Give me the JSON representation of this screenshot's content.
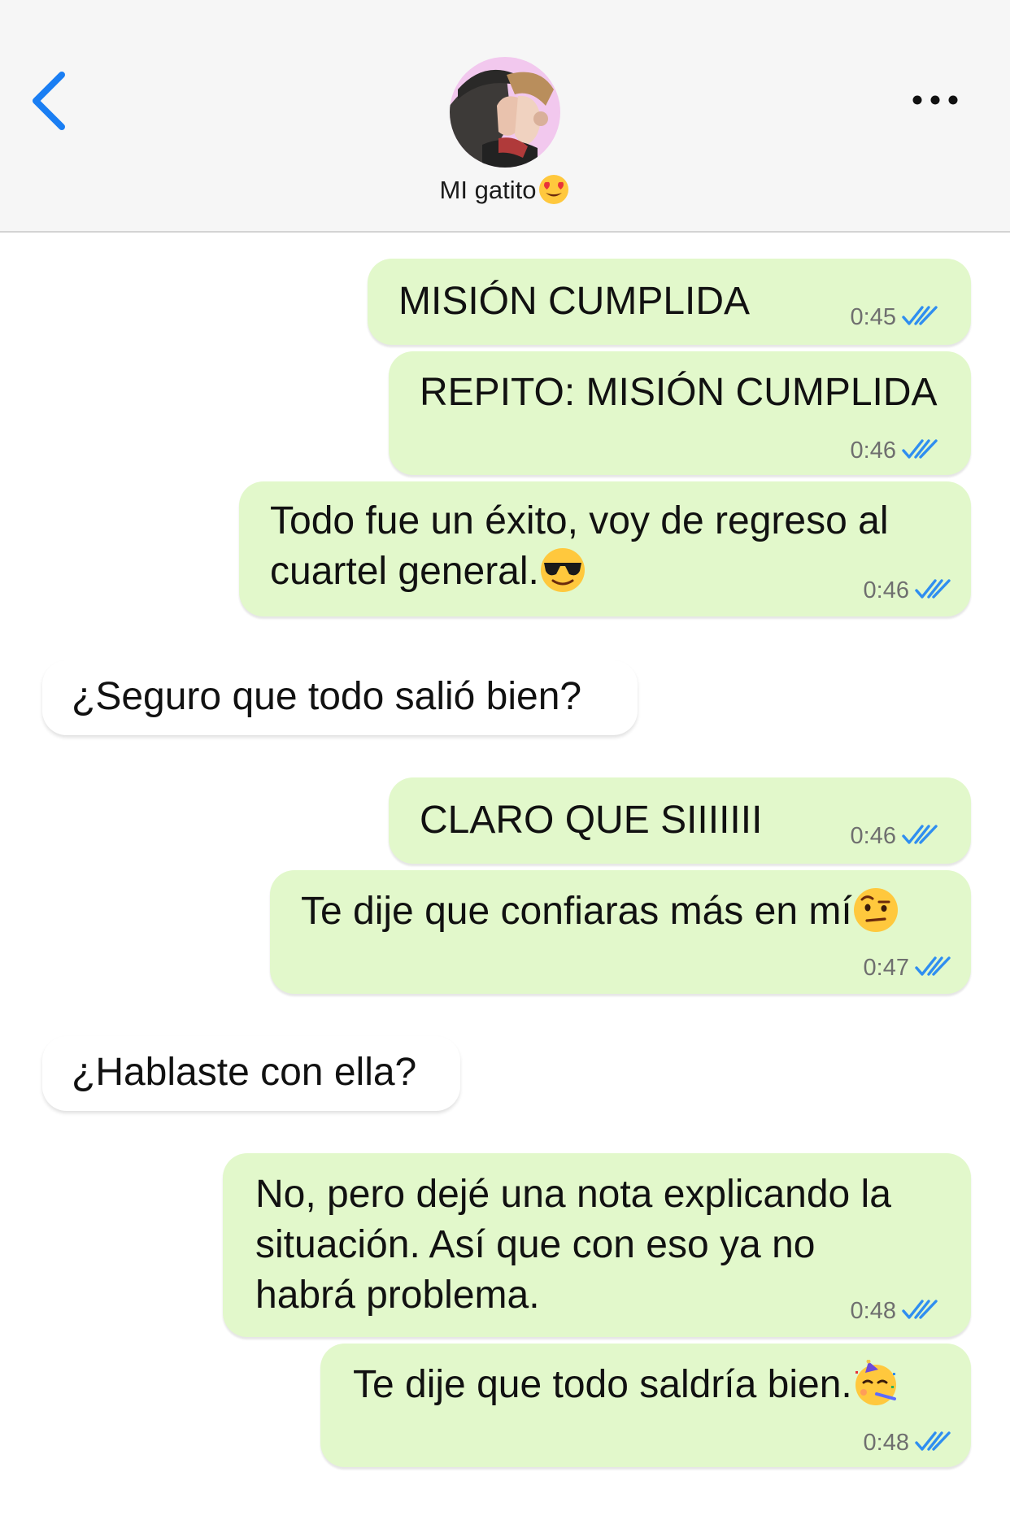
{
  "header": {
    "contact_name": "MI gatito",
    "contact_emoji": "smiling-face-with-heart-eyes-emoji",
    "back_icon": "chevron-left-icon",
    "more_icon": "more-dots-icon",
    "accent_color": "#1a7ef3"
  },
  "messages": [
    {
      "direction": "outgoing",
      "text": "MISIÓN CUMPLIDA",
      "time": "0:45",
      "status": "read"
    },
    {
      "direction": "outgoing",
      "text": "REPITO: MISIÓN CUMPLIDA",
      "time": "0:46",
      "status": "read"
    },
    {
      "direction": "outgoing",
      "lines": [
        "Todo fue un éxito, voy de regreso al",
        "cuartel general."
      ],
      "emoji": "smiling-face-with-sunglasses-emoji",
      "time": "0:46",
      "status": "read"
    },
    {
      "direction": "incoming",
      "text": "¿Seguro que todo salió bien?"
    },
    {
      "direction": "outgoing",
      "text": "CLARO QUE SIIIIIII",
      "time": "0:46",
      "status": "read"
    },
    {
      "direction": "outgoing",
      "text": "Te dije que confiaras más en mí",
      "emoji": "face-with-raised-eyebrow-emoji",
      "time": "0:47",
      "status": "read"
    },
    {
      "direction": "incoming",
      "text": "¿Hablaste con ella?"
    },
    {
      "direction": "outgoing",
      "lines": [
        "No, pero dejé una nota explicando la",
        "situación. Así que con eso ya no",
        "habrá problema."
      ],
      "time": "0:48",
      "status": "read"
    },
    {
      "direction": "outgoing",
      "text": "Te dije que todo saldría bien.",
      "emoji": "partying-face-emoji",
      "time": "0:48",
      "status": "read"
    }
  ],
  "colors": {
    "outgoing_bubble": "#e2f8cb",
    "incoming_bubble": "#ffffff",
    "read_ticks": "#2f8ef0",
    "header_bg": "#f6f6f6"
  }
}
